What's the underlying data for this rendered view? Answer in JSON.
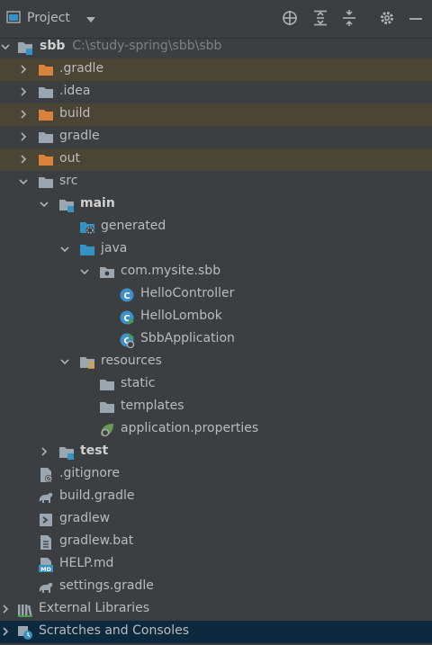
{
  "header": {
    "title": "Project"
  },
  "tree": {
    "sbb": {
      "name": "sbb",
      "path": "C:\\study-spring\\sbb\\sbb"
    },
    "gradle_hidden": ".gradle",
    "idea": ".idea",
    "build": "build",
    "gradle": "gradle",
    "out": "out",
    "src": "src",
    "main": "main",
    "generated": "generated",
    "java": "java",
    "package": "com.mysite.sbb",
    "hello_controller": "HelloController",
    "hello_lombok": "HelloLombok",
    "sbb_application": "SbbApplication",
    "resources": "resources",
    "static": "static",
    "templates": "templates",
    "application_properties": "application.properties",
    "test": "test",
    "gitignore": ".gitignore",
    "build_gradle": "build.gradle",
    "gradlew": "gradlew",
    "gradlew_bat": "gradlew.bat",
    "help_md": "HELP.md",
    "settings_gradle": "settings.gradle",
    "external_libraries": "External Libraries",
    "scratches": "Scratches and Consoles"
  },
  "colors": {
    "background": "#3c3f41",
    "excluded_row": "#4b4536",
    "selected_row": "#0d293e",
    "folder_gray": "#9aa7b0",
    "folder_orange": "#d9823b",
    "source_blue": "#3592c4",
    "class_blue": "#3f8fc9",
    "spring_green": "#6a9955"
  }
}
